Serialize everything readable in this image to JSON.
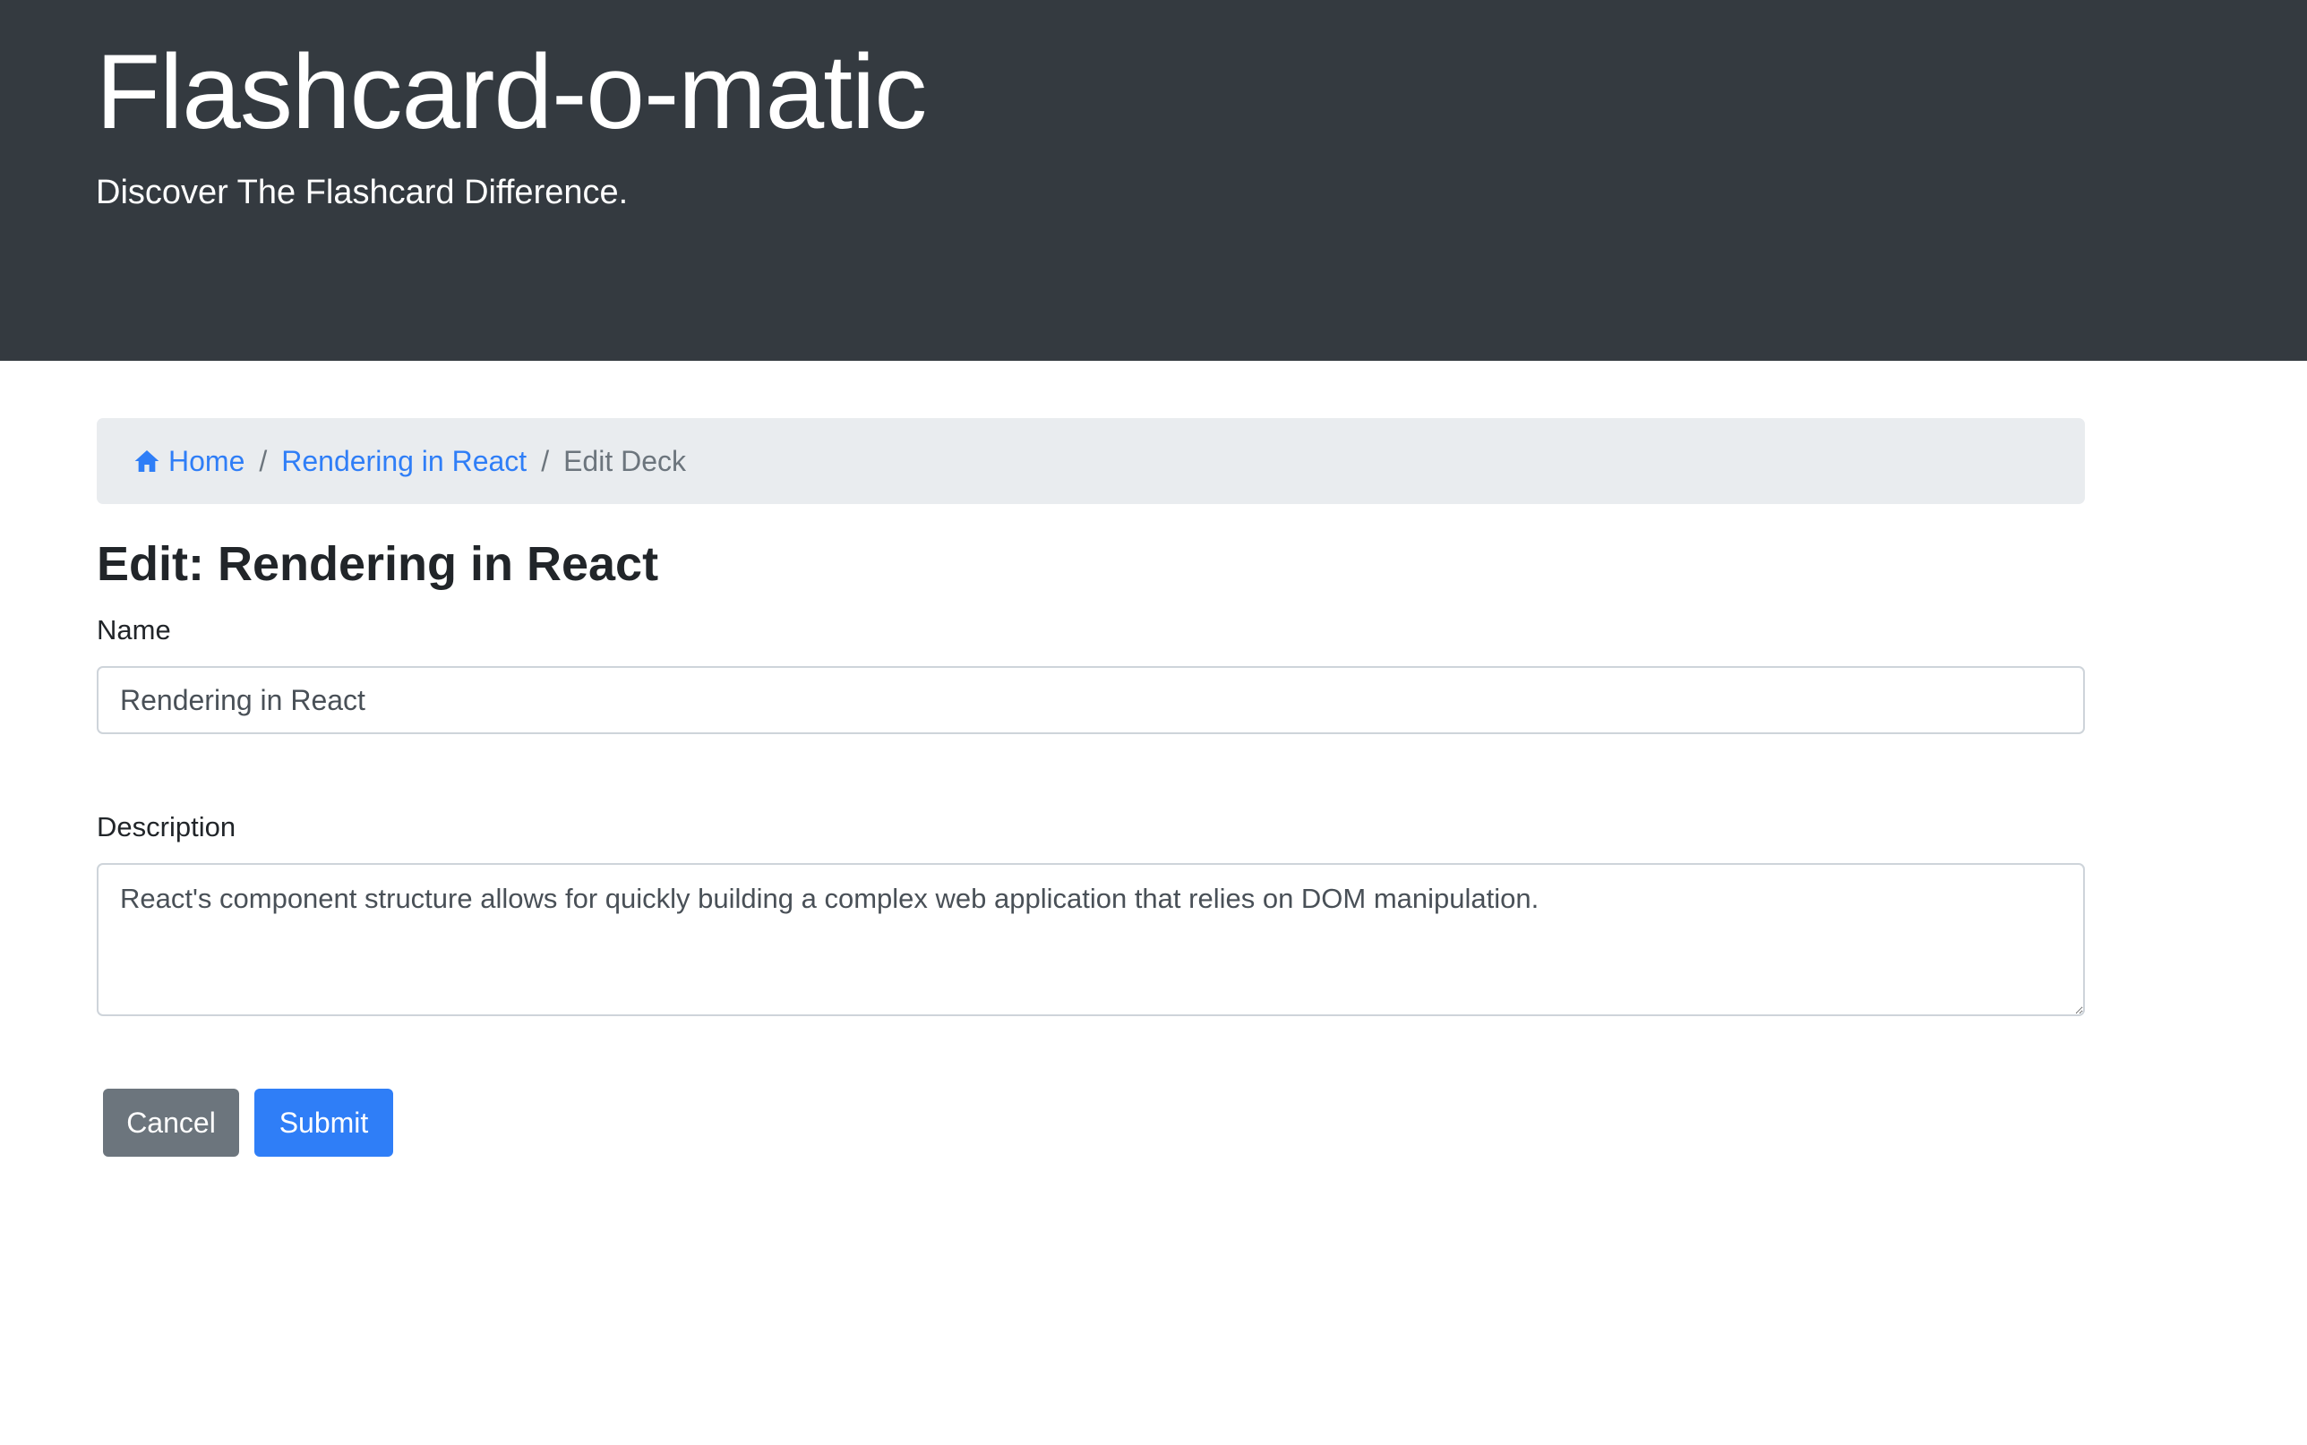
{
  "header": {
    "title": "Flashcard-o-matic",
    "tagline": "Discover The Flashcard Difference."
  },
  "breadcrumb": {
    "home_label": "Home",
    "deck_label": "Rendering in React",
    "current_label": "Edit Deck",
    "separator": "/"
  },
  "page": {
    "heading": "Edit: Rendering in React"
  },
  "form": {
    "name_label": "Name",
    "name_value": "Rendering in React",
    "description_label": "Description",
    "description_value": "React's component structure allows for quickly building a complex web application that relies on DOM manipulation.",
    "cancel_label": "Cancel",
    "submit_label": "Submit"
  },
  "colors": {
    "header_bg": "#343a40",
    "link": "#2f7ef7",
    "breadcrumb_bg": "#e9ecef",
    "cancel_bg": "#6c757d",
    "submit_bg": "#2f7ef7"
  },
  "icons": {
    "home": "home-icon"
  }
}
